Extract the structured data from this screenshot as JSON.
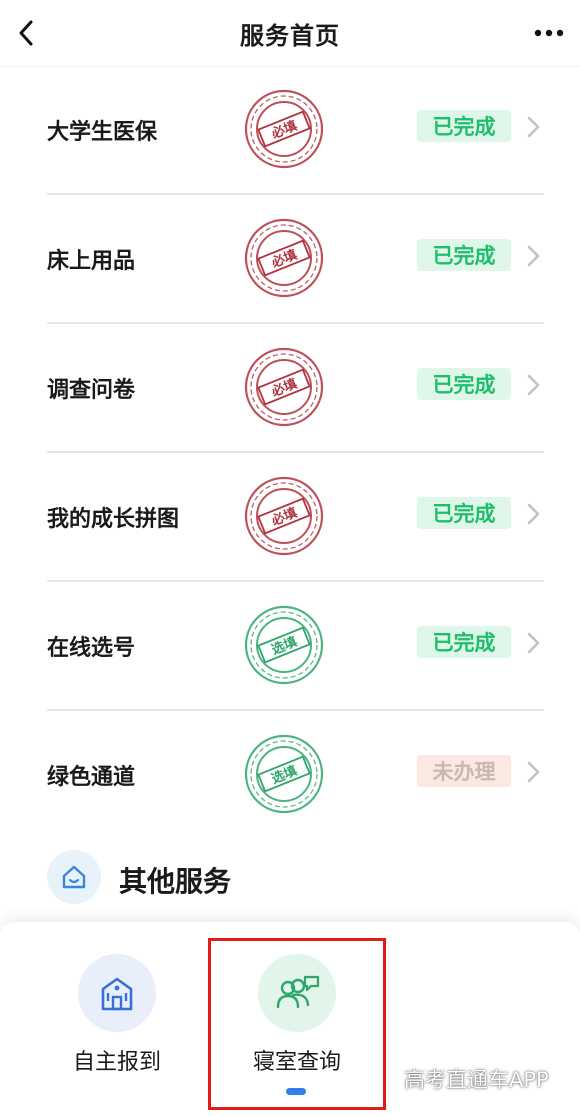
{
  "header": {
    "title": "服务首页",
    "back_icon": "chevron-left-icon",
    "more_icon": "more-dots-icon"
  },
  "tasks": [
    {
      "label": "大学生医保",
      "stamp_text": "必填",
      "stamp_color": "#b0333e",
      "status": "已完成",
      "status_type": "done"
    },
    {
      "label": "床上用品",
      "stamp_text": "必填",
      "stamp_color": "#b0333e",
      "status": "已完成",
      "status_type": "done"
    },
    {
      "label": "调查问卷",
      "stamp_text": "必填",
      "stamp_color": "#b0333e",
      "status": "已完成",
      "status_type": "done"
    },
    {
      "label": "我的成长拼图",
      "stamp_text": "必填",
      "stamp_color": "#b0333e",
      "status": "已完成",
      "status_type": "done"
    },
    {
      "label": "在线选号",
      "stamp_text": "选填",
      "stamp_color": "#2fa66a",
      "status": "已完成",
      "status_type": "done"
    },
    {
      "label": "绿色通道",
      "stamp_text": "选填",
      "stamp_color": "#2fa66a",
      "status": "未办理",
      "status_type": "pending"
    }
  ],
  "other_services": {
    "title": "其他服务",
    "icon": "home-icon",
    "items": [
      {
        "label": "自主报到",
        "icon": "building-icon",
        "icon_bg": "#e8effb",
        "icon_color": "#3b6fd6"
      },
      {
        "label": "寝室查询",
        "icon": "people-chat-icon",
        "icon_bg": "#e2f5ea",
        "icon_color": "#2fa66a"
      }
    ]
  },
  "watermark": "高考直通车APP",
  "colors": {
    "done_text": "#1fbf6a",
    "done_bg": "#dff7ea",
    "pending_text": "#c7b8b4",
    "pending_bg": "#fbe8e3",
    "highlight": "#e01919",
    "indicator": "#2f80ed"
  }
}
